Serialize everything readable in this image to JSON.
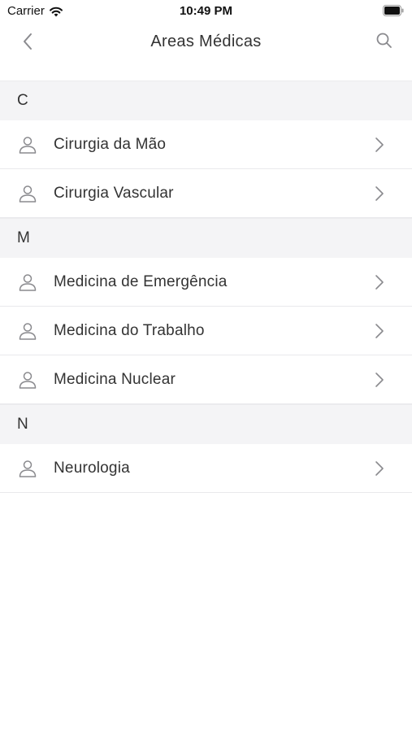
{
  "status_bar": {
    "carrier": "Carrier",
    "time": "10:49 PM",
    "icons": [
      "wifi-icon",
      "battery-icon"
    ]
  },
  "nav": {
    "title": "Areas Médicas",
    "back_icon": "chevron-left-icon",
    "search_icon": "search-icon"
  },
  "sections": [
    {
      "letter": "C",
      "items": [
        {
          "label": "Cirurgia da Mão"
        },
        {
          "label": "Cirurgia Vascular"
        }
      ]
    },
    {
      "letter": "M",
      "items": [
        {
          "label": "Medicina de Emergência"
        },
        {
          "label": "Medicina do Trabalho"
        },
        {
          "label": "Medicina Nuclear"
        }
      ]
    },
    {
      "letter": "N",
      "items": [
        {
          "label": "Neurologia"
        }
      ]
    }
  ],
  "colors": {
    "section_background": "#f4f4f6",
    "icon_gray": "#8a8a8e",
    "text": "#333333"
  }
}
